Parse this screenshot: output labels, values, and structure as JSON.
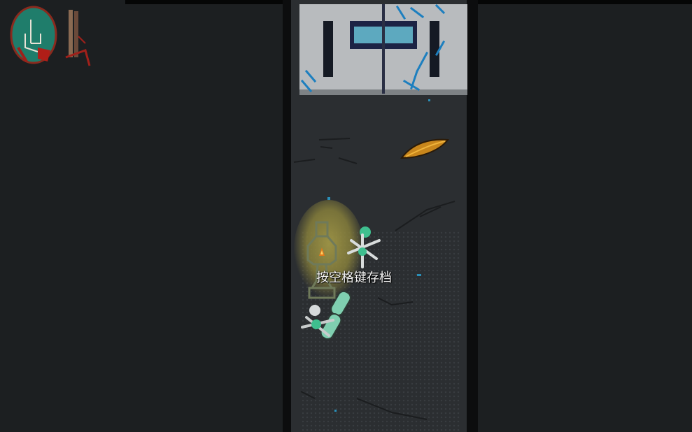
{
  "hud": {
    "portrait_icon": "hand-sign-portrait-icon",
    "item_icon": "bloody-stick-icon",
    "accent_color": "#1f7d6b",
    "blood_color": "#a0201a"
  },
  "scene": {
    "save_prompt": "按空格键存档",
    "lamp_icon": "save-lantern-icon",
    "leaf_icon": "golden-leaf-icon",
    "skeleton_icon": "teal-skeleton-icon",
    "glow_color": "#a99a46"
  }
}
